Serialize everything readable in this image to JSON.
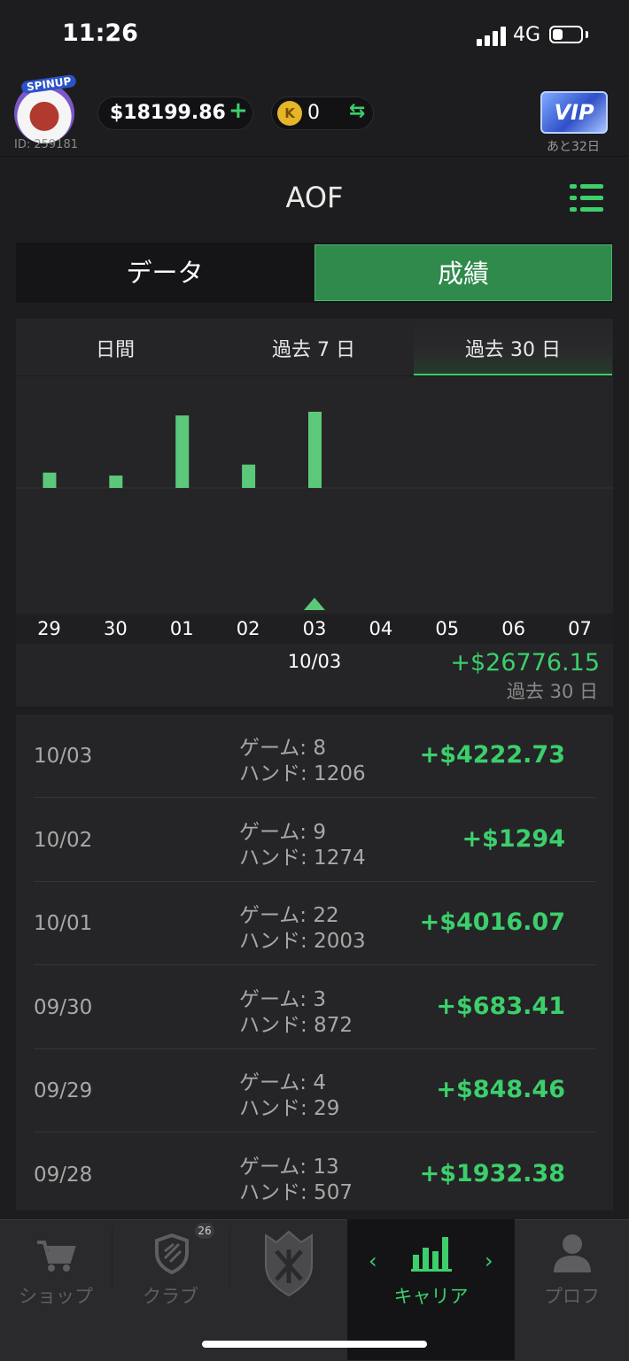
{
  "status_bar": {
    "time": "11:26",
    "network": "4G",
    "battery_level": 0.35
  },
  "header": {
    "avatar_badge": "SPINUP",
    "user_id": "ID: 259181",
    "balance": "$18199.86",
    "balance_add": "+",
    "coin_letter": "K",
    "coins": "0",
    "exchange": "⇆",
    "vip_label": "VIP",
    "vip_remaining": "あと32日"
  },
  "page": {
    "title": "AOF"
  },
  "segments": {
    "data": "データ",
    "results": "成績",
    "active": "results"
  },
  "period_tabs": {
    "daily": "日間",
    "week": "過去 7 日",
    "month": "過去 30 日",
    "active": "month"
  },
  "chart_data": {
    "type": "bar",
    "categories": [
      "29",
      "30",
      "01",
      "02",
      "03",
      "04",
      "05",
      "06",
      "07"
    ],
    "values": [
      848.46,
      683.41,
      4016.07,
      1294,
      4222.73,
      null,
      null,
      null,
      null
    ],
    "selected_index": 4,
    "accent_color": "#5cc97a"
  },
  "summary": {
    "selected_date": "10/03",
    "total": "+$26776.15",
    "total_caption": "過去 30 日"
  },
  "records": [
    {
      "date": "10/03",
      "games": "ゲーム:  8",
      "hands": "ハンド:  1206",
      "amount": "+$4222.73"
    },
    {
      "date": "10/02",
      "games": "ゲーム:  9",
      "hands": "ハンド:  1274",
      "amount": "+$1294"
    },
    {
      "date": "10/01",
      "games": "ゲーム:  22",
      "hands": "ハンド:  2003",
      "amount": "+$4016.07"
    },
    {
      "date": "09/30",
      "games": "ゲーム:  3",
      "hands": "ハンド:  872",
      "amount": "+$683.41"
    },
    {
      "date": "09/29",
      "games": "ゲーム:  4",
      "hands": "ハンド:  29",
      "amount": "+$848.46"
    },
    {
      "date": "09/28",
      "games": "ゲーム:  13",
      "hands": "ハンド:  507",
      "amount": "+$1932.38"
    }
  ],
  "nav": {
    "shop": "ショップ",
    "club": "クラブ",
    "club_badge": "26",
    "career": "キャリア",
    "profile": "プロフ",
    "prev": "‹",
    "next": "›",
    "active": "career"
  }
}
